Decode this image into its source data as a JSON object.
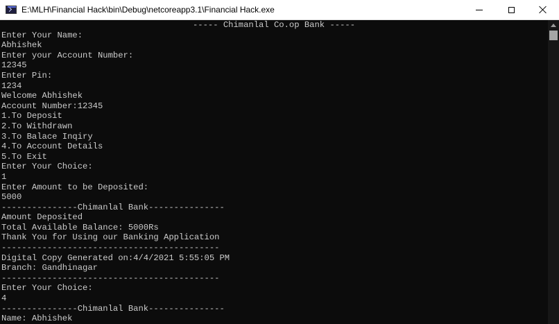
{
  "window": {
    "title": "E:\\MLH\\Financial Hack\\bin\\Debug\\netcoreapp3.1\\Financial Hack.exe",
    "icon": "console-app-icon",
    "controls": [
      "minimize-icon",
      "maximize-icon",
      "close-icon"
    ]
  },
  "console": {
    "header": "----- Chimanlal Co.op Bank -----",
    "lines": [
      "Enter Your Name:",
      "Abhishek",
      "Enter your Account Number:",
      "12345",
      "Enter Pin:",
      "1234",
      "Welcome Abhishek",
      "Account Number:12345",
      "1.To Deposit",
      "2.To Withdrawn",
      "3.To Balace Inqiry",
      "4.To Account Details",
      "5.To Exit",
      "Enter Your Choice:",
      "1",
      "Enter Amount to be Deposited:",
      "5000",
      "---------------Chimanlal Bank---------------",
      "Amount Deposited",
      "Total Available Balance: 5000Rs",
      "Thank You for Using our Banking Application",
      "-------------------------------------------",
      "Digital Copy Generated on:4/4/2021 5:55:05 PM",
      "Branch: Gandhinagar",
      "-------------------------------------------",
      "Enter Your Choice:",
      "4",
      "---------------Chimanlal Bank---------------",
      "Name: Abhishek"
    ],
    "colors": {
      "background": "#0c0c0c",
      "text": "#cccccc"
    }
  }
}
